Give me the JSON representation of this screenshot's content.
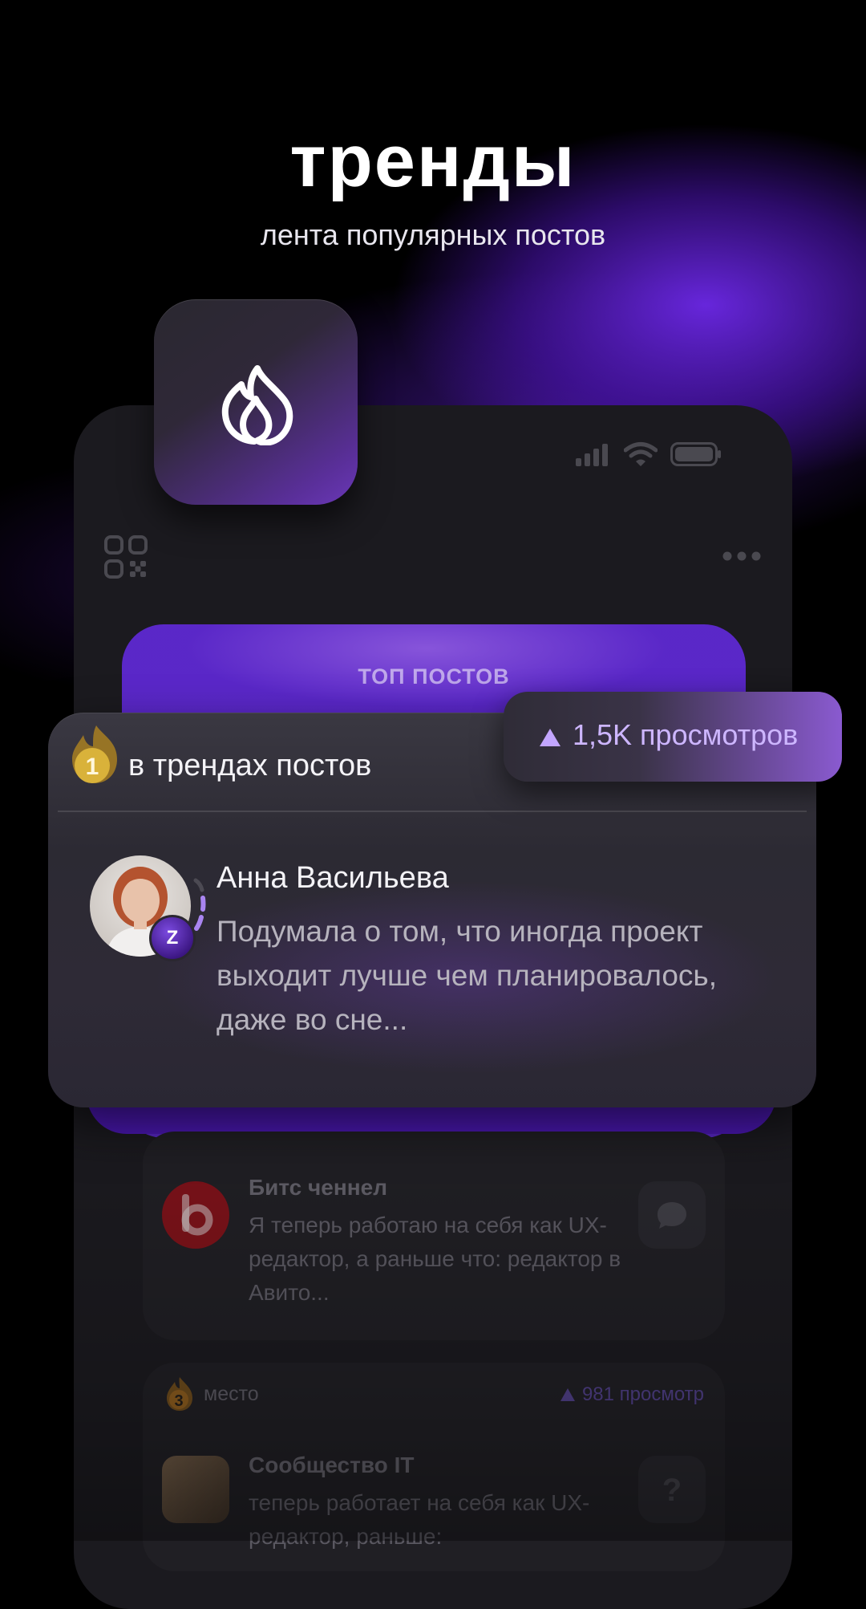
{
  "hero": {
    "title": "тренды",
    "subtitle": "лента популярных постов"
  },
  "icons": {
    "hero_tile": "fire-icon",
    "status": [
      "signal-icon",
      "wifi-icon",
      "battery-icon"
    ],
    "top_left": "qr-code-icon",
    "top_right": "more-dots-icon"
  },
  "top_card": {
    "label": "ТОП ПОСТОВ"
  },
  "trend_card": {
    "rank": "1",
    "heading": "в трендах постов",
    "views": "1,5K просмотров",
    "author": "Анна Васильева",
    "author_badge": "Z",
    "post_text": "Подумала о том, что иногда проект выходит лучше чем планировалось, даже во сне..."
  },
  "list": [
    {
      "title": "Битс ченнел",
      "text": "Я теперь работаю на себя как UX-редактор, а раньше что: редактор в Авито...",
      "action_icon": "chat-bubble-icon"
    },
    {
      "rank": "3",
      "place": "место",
      "views": "981 просмотр",
      "title": "Сообщество IT",
      "text": "теперь работает на себя как UX-редактор, раньше:",
      "action_icon": "question-icon"
    }
  ],
  "colors": {
    "accent": "#6a2ee0",
    "views_text": "#cdb6ff",
    "rank_gold": "#d9b23a"
  }
}
